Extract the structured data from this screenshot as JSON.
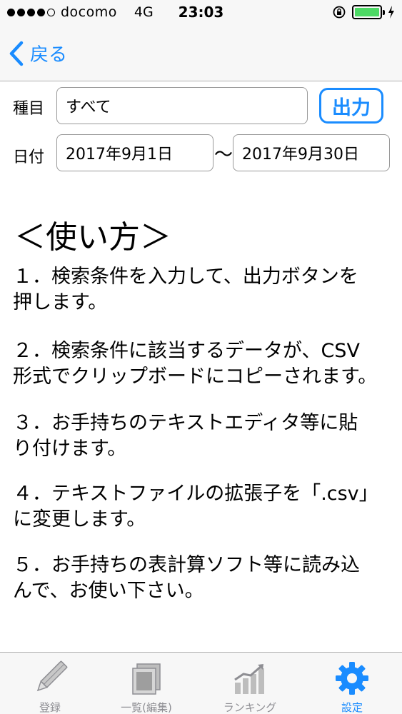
{
  "status_bar": {
    "carrier": "docomo",
    "network": "4G",
    "time": "23:03",
    "battery_color": "#4cd964"
  },
  "nav": {
    "back_label": "戻る"
  },
  "form": {
    "category_label": "種目",
    "category_value": "すべて",
    "output_button": "出力",
    "date_label": "日付",
    "date_from": "2017年9月1日",
    "date_separator": "〜",
    "date_to": "2017年9月30日"
  },
  "instructions": {
    "title": "＜使い方＞",
    "steps": [
      {
        "line1": "１．検索条件を入力して、出力ボタンを",
        "line2": "押します。"
      },
      {
        "line1": "２．検索条件に該当するデータが、CSV",
        "line2": "形式でクリップボードにコピーされます。"
      },
      {
        "line1": "３．お手持ちのテキストエディタ等に貼",
        "line2": "り付けます。"
      },
      {
        "line1": "４．テキストファイルの拡張子を「.csv」",
        "line2": "に変更します。"
      },
      {
        "line1": "５．お手持ちの表計算ソフト等に読み込",
        "line2": "んで、お使い下さい。"
      }
    ]
  },
  "tab_bar": {
    "tabs": [
      {
        "label": "登録",
        "icon": "pencil-icon"
      },
      {
        "label": "一覧(編集)",
        "icon": "list-icon"
      },
      {
        "label": "ランキング",
        "icon": "chart-icon"
      },
      {
        "label": "設定",
        "icon": "gear-icon"
      }
    ],
    "active_index": 3,
    "accent_color": "#1a8cff",
    "inactive_color": "#8e8e93"
  }
}
